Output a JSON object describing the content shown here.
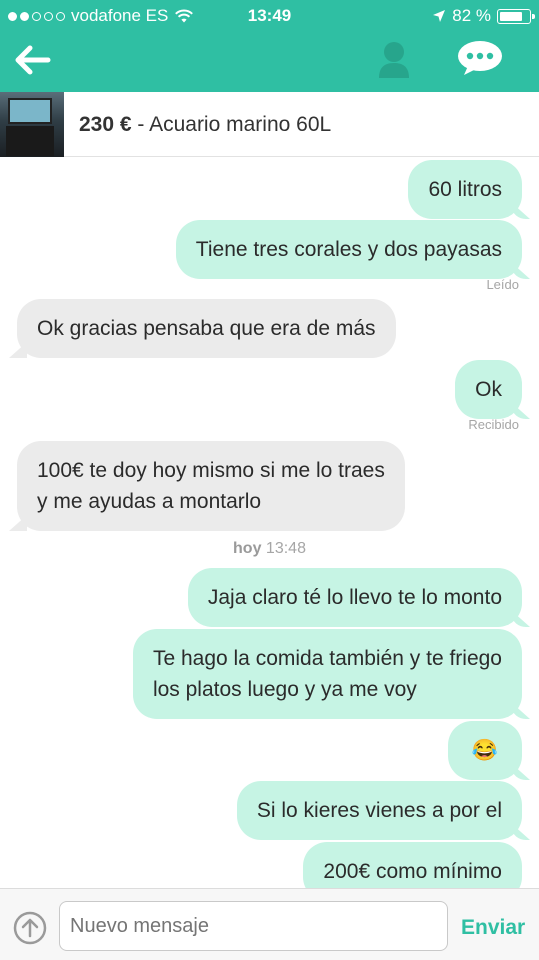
{
  "status_bar": {
    "carrier": "vodafone ES",
    "time": "13:49",
    "battery": "82 %",
    "battery_level": 0.82
  },
  "nav": {
    "icons": [
      "back-arrow-icon",
      "user-icon",
      "chat-bubble-icon"
    ]
  },
  "item": {
    "price": "230 €",
    "separator": " - ",
    "name": "Acuario marino 60L"
  },
  "messages": [
    {
      "side": "out",
      "text": "60 litros"
    },
    {
      "side": "out",
      "text": "Tiene tres corales y dos payasas",
      "receipt": "Leído"
    },
    {
      "side": "in",
      "text": "Ok gracias pensaba que era de más"
    },
    {
      "side": "out",
      "text": "Ok",
      "receipt": "Recibido"
    },
    {
      "side": "in",
      "line1": "100€ te doy hoy mismo si me lo traes",
      "line2": "y me ayudas a montarlo"
    },
    {
      "side": "out",
      "text": "Jaja claro té lo llevo te lo monto"
    },
    {
      "side": "out",
      "line1": "Te hago la comida también y te friego",
      "line2": "los platos luego y ya me voy"
    },
    {
      "side": "out",
      "emoji": "😂"
    },
    {
      "side": "out",
      "text": "Si lo kieres vienes a por el"
    },
    {
      "side": "out",
      "text": "200€ como mínimo"
    }
  ],
  "day_separator": {
    "day": "hoy",
    "time": "13:48"
  },
  "compose": {
    "placeholder": "Nuevo mensaje",
    "send_label": "Enviar"
  },
  "colors": {
    "accent": "#2fbfa3",
    "outgoing_bubble": "#c6f4e4",
    "incoming_bubble": "#ebebeb"
  }
}
